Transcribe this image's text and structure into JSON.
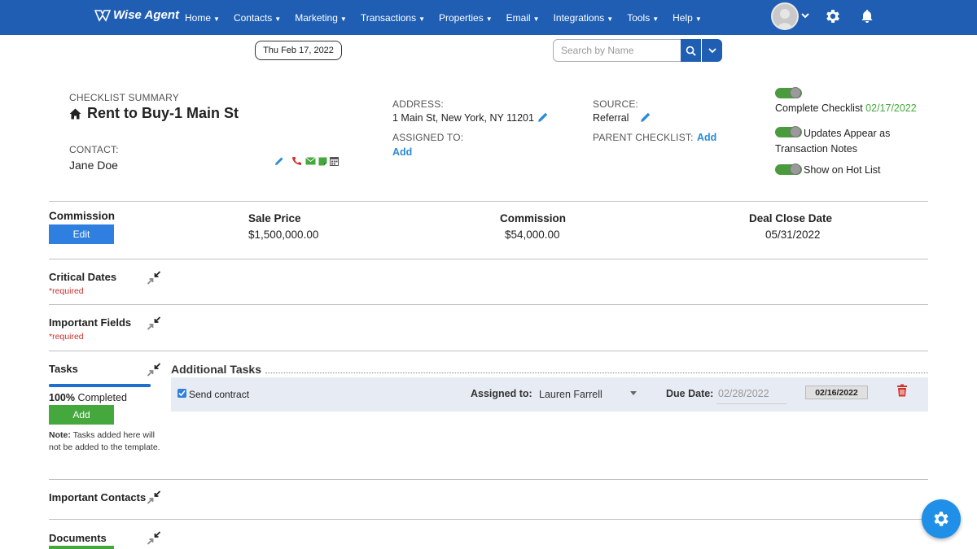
{
  "nav": {
    "logo_text": "Wise Agent",
    "items": [
      "Home",
      "Contacts",
      "Marketing",
      "Transactions",
      "Properties",
      "Email",
      "Integrations",
      "Tools",
      "Help"
    ],
    "brand_color": "#1f5eb3"
  },
  "toolbar": {
    "date": "Thu Feb 17, 2022",
    "search_placeholder": "Search by Name"
  },
  "summary": {
    "label": "CHECKLIST SUMMARY",
    "title": "Rent to Buy-1 Main St",
    "contact_label": "CONTACT:",
    "contact_name": "Jane Doe",
    "address_label": "ADDRESS:",
    "address": "1 Main St, New York, NY 11201",
    "assigned_label": "ASSIGNED TO:",
    "assigned_add": "Add",
    "source_label": "SOURCE:",
    "source": "Referral",
    "parent_label": "PARENT CHECKLIST:",
    "parent_add": "Add"
  },
  "toggles": {
    "complete_label": "Complete Checklist",
    "complete_date": "02/17/2022",
    "updates_label_line1": "Updates Appear as",
    "updates_label_line2": "Transaction Notes",
    "hotlist_label": "Show on Hot List"
  },
  "commission": {
    "title": "Commission",
    "edit_label": "Edit",
    "sale_price_label": "Sale Price",
    "sale_price": "$1,500,000.00",
    "commission_label": "Commission",
    "commission_value": "$54,000.00",
    "close_label": "Deal Close Date",
    "close_date": "05/31/2022"
  },
  "sections": {
    "critical_dates": "Critical Dates",
    "important_fields": "Important Fields",
    "required": "required",
    "tasks": "Tasks",
    "important_contacts": "Important Contacts",
    "documents": "Documents"
  },
  "tasks": {
    "progress_percent": 100,
    "progress_value": "100%",
    "progress_text": "Completed",
    "add_label": "Add",
    "note_label": "Note:",
    "note_text": "Tasks added here will not be added to the template.",
    "additional_title": "Additional Tasks",
    "items": [
      {
        "name": "Send contract",
        "assigned_label": "Assigned to:",
        "assignee": "Lauren Farrell",
        "due_label": "Due Date:",
        "due_date": "02/28/2022",
        "completed_date": "02/16/2022"
      }
    ]
  }
}
